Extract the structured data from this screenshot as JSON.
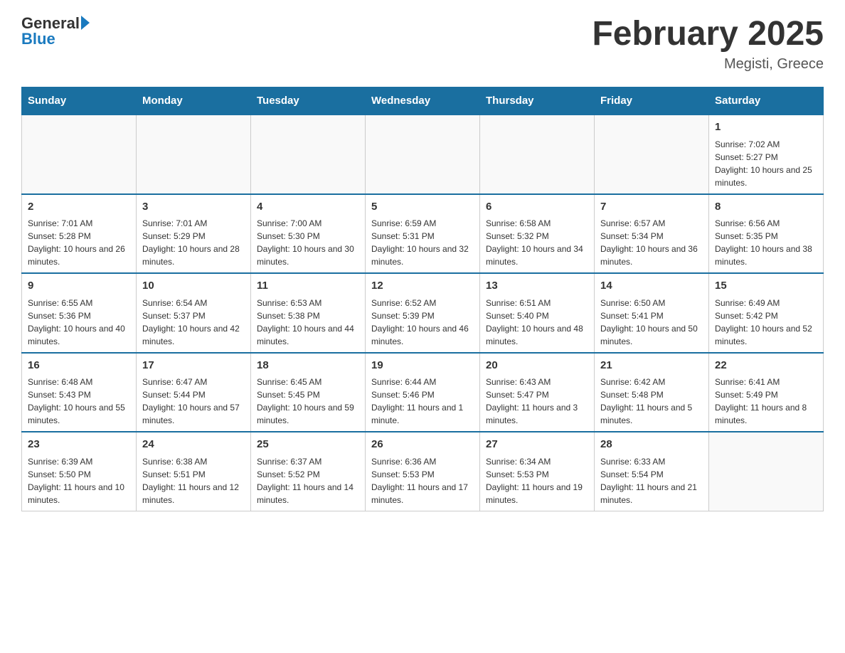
{
  "logo": {
    "general": "General",
    "blue": "Blue"
  },
  "header": {
    "title": "February 2025",
    "subtitle": "Megisti, Greece"
  },
  "days": [
    "Sunday",
    "Monday",
    "Tuesday",
    "Wednesday",
    "Thursday",
    "Friday",
    "Saturday"
  ],
  "weeks": [
    {
      "cells": [
        {
          "day": null,
          "info": ""
        },
        {
          "day": null,
          "info": ""
        },
        {
          "day": null,
          "info": ""
        },
        {
          "day": null,
          "info": ""
        },
        {
          "day": null,
          "info": ""
        },
        {
          "day": null,
          "info": ""
        },
        {
          "day": 1,
          "info": "Sunrise: 7:02 AM\nSunset: 5:27 PM\nDaylight: 10 hours and 25 minutes."
        }
      ]
    },
    {
      "cells": [
        {
          "day": 2,
          "info": "Sunrise: 7:01 AM\nSunset: 5:28 PM\nDaylight: 10 hours and 26 minutes."
        },
        {
          "day": 3,
          "info": "Sunrise: 7:01 AM\nSunset: 5:29 PM\nDaylight: 10 hours and 28 minutes."
        },
        {
          "day": 4,
          "info": "Sunrise: 7:00 AM\nSunset: 5:30 PM\nDaylight: 10 hours and 30 minutes."
        },
        {
          "day": 5,
          "info": "Sunrise: 6:59 AM\nSunset: 5:31 PM\nDaylight: 10 hours and 32 minutes."
        },
        {
          "day": 6,
          "info": "Sunrise: 6:58 AM\nSunset: 5:32 PM\nDaylight: 10 hours and 34 minutes."
        },
        {
          "day": 7,
          "info": "Sunrise: 6:57 AM\nSunset: 5:34 PM\nDaylight: 10 hours and 36 minutes."
        },
        {
          "day": 8,
          "info": "Sunrise: 6:56 AM\nSunset: 5:35 PM\nDaylight: 10 hours and 38 minutes."
        }
      ]
    },
    {
      "cells": [
        {
          "day": 9,
          "info": "Sunrise: 6:55 AM\nSunset: 5:36 PM\nDaylight: 10 hours and 40 minutes."
        },
        {
          "day": 10,
          "info": "Sunrise: 6:54 AM\nSunset: 5:37 PM\nDaylight: 10 hours and 42 minutes."
        },
        {
          "day": 11,
          "info": "Sunrise: 6:53 AM\nSunset: 5:38 PM\nDaylight: 10 hours and 44 minutes."
        },
        {
          "day": 12,
          "info": "Sunrise: 6:52 AM\nSunset: 5:39 PM\nDaylight: 10 hours and 46 minutes."
        },
        {
          "day": 13,
          "info": "Sunrise: 6:51 AM\nSunset: 5:40 PM\nDaylight: 10 hours and 48 minutes."
        },
        {
          "day": 14,
          "info": "Sunrise: 6:50 AM\nSunset: 5:41 PM\nDaylight: 10 hours and 50 minutes."
        },
        {
          "day": 15,
          "info": "Sunrise: 6:49 AM\nSunset: 5:42 PM\nDaylight: 10 hours and 52 minutes."
        }
      ]
    },
    {
      "cells": [
        {
          "day": 16,
          "info": "Sunrise: 6:48 AM\nSunset: 5:43 PM\nDaylight: 10 hours and 55 minutes."
        },
        {
          "day": 17,
          "info": "Sunrise: 6:47 AM\nSunset: 5:44 PM\nDaylight: 10 hours and 57 minutes."
        },
        {
          "day": 18,
          "info": "Sunrise: 6:45 AM\nSunset: 5:45 PM\nDaylight: 10 hours and 59 minutes."
        },
        {
          "day": 19,
          "info": "Sunrise: 6:44 AM\nSunset: 5:46 PM\nDaylight: 11 hours and 1 minute."
        },
        {
          "day": 20,
          "info": "Sunrise: 6:43 AM\nSunset: 5:47 PM\nDaylight: 11 hours and 3 minutes."
        },
        {
          "day": 21,
          "info": "Sunrise: 6:42 AM\nSunset: 5:48 PM\nDaylight: 11 hours and 5 minutes."
        },
        {
          "day": 22,
          "info": "Sunrise: 6:41 AM\nSunset: 5:49 PM\nDaylight: 11 hours and 8 minutes."
        }
      ]
    },
    {
      "cells": [
        {
          "day": 23,
          "info": "Sunrise: 6:39 AM\nSunset: 5:50 PM\nDaylight: 11 hours and 10 minutes."
        },
        {
          "day": 24,
          "info": "Sunrise: 6:38 AM\nSunset: 5:51 PM\nDaylight: 11 hours and 12 minutes."
        },
        {
          "day": 25,
          "info": "Sunrise: 6:37 AM\nSunset: 5:52 PM\nDaylight: 11 hours and 14 minutes."
        },
        {
          "day": 26,
          "info": "Sunrise: 6:36 AM\nSunset: 5:53 PM\nDaylight: 11 hours and 17 minutes."
        },
        {
          "day": 27,
          "info": "Sunrise: 6:34 AM\nSunset: 5:53 PM\nDaylight: 11 hours and 19 minutes."
        },
        {
          "day": 28,
          "info": "Sunrise: 6:33 AM\nSunset: 5:54 PM\nDaylight: 11 hours and 21 minutes."
        },
        {
          "day": null,
          "info": ""
        }
      ]
    }
  ]
}
